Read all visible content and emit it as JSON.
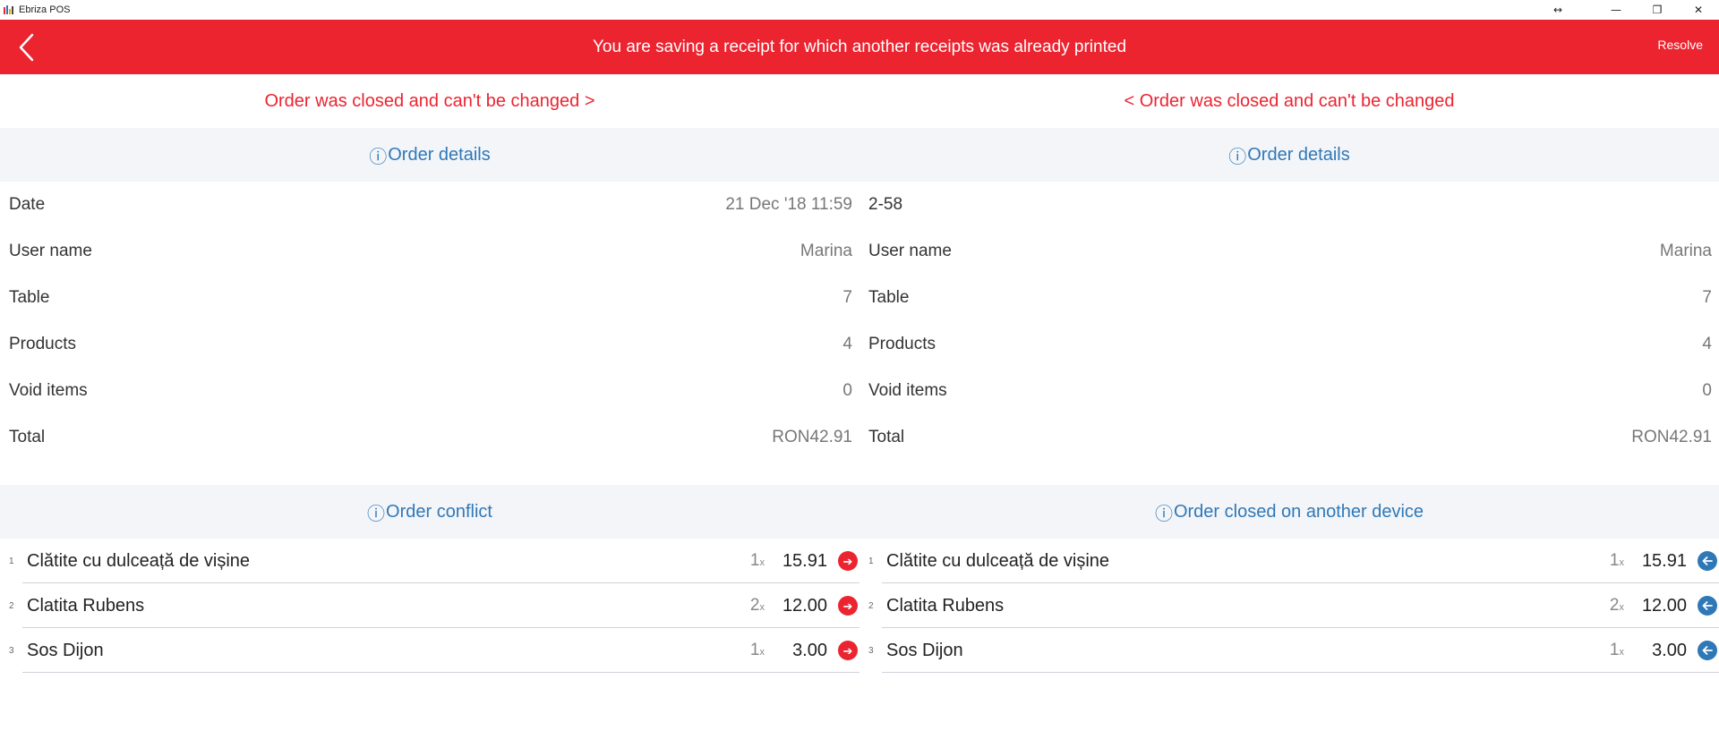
{
  "window": {
    "title": "Ebriza POS",
    "controls": {
      "resize": "↔",
      "minimize": "—",
      "restore": "❐",
      "close": "✕"
    },
    "logo_colors": [
      "#eb2430",
      "#2f78b8",
      "#f2a900",
      "#444444"
    ]
  },
  "banner": {
    "message": "You are saving a receipt for which another receipts was already printed",
    "resolve_label": "Resolve",
    "back_icon": "chevron-left-icon",
    "color": "#eb2430"
  },
  "left": {
    "status_link": "Order was closed and can't be changed >",
    "details_header": "Order details",
    "details": [
      {
        "label": "Date",
        "value": "21 Dec '18 11:59"
      },
      {
        "label": "User name",
        "value": "Marina"
      },
      {
        "label": "Table",
        "value": "7"
      },
      {
        "label": "Products",
        "value": "4"
      },
      {
        "label": "Void items",
        "value": "0"
      },
      {
        "label": "Total",
        "value": "RON42.91"
      }
    ],
    "items_header": "Order conflict",
    "items": [
      {
        "index": "1",
        "name": "Clătite cu dulceață de vișine",
        "qty": "1",
        "qty_suffix": "x",
        "price": "15.91",
        "action_icon": "arrow-right-circle-icon"
      },
      {
        "index": "2",
        "name": "Clatita Rubens",
        "qty": "2",
        "qty_suffix": "x",
        "price": "12.00",
        "action_icon": "arrow-right-circle-icon"
      },
      {
        "index": "3",
        "name": "Sos Dijon",
        "qty": "1",
        "qty_suffix": "x",
        "price": "3.00",
        "action_icon": "arrow-right-circle-icon"
      }
    ]
  },
  "right": {
    "status_link": "< Order was closed and can't be changed",
    "details_header": "Order details",
    "details": [
      {
        "label": "2-58",
        "value": ""
      },
      {
        "label": "User name",
        "value": "Marina"
      },
      {
        "label": "Table",
        "value": "7"
      },
      {
        "label": "Products",
        "value": "4"
      },
      {
        "label": "Void items",
        "value": "0"
      },
      {
        "label": "Total",
        "value": "RON42.91"
      }
    ],
    "items_header": "Order closed on another device",
    "items": [
      {
        "index": "1",
        "name": "Clătite cu dulceață de vișine",
        "qty": "1",
        "qty_suffix": "x",
        "price": "15.91",
        "action_icon": "arrow-left-circle-icon"
      },
      {
        "index": "2",
        "name": "Clatita Rubens",
        "qty": "2",
        "qty_suffix": "x",
        "price": "12.00",
        "action_icon": "arrow-left-circle-icon"
      },
      {
        "index": "3",
        "name": "Sos Dijon",
        "qty": "1",
        "qty_suffix": "x",
        "price": "3.00",
        "action_icon": "arrow-left-circle-icon"
      }
    ]
  },
  "icons": {
    "info": "ⓘ",
    "arrow_right": "➔",
    "arrow_left": "🡐"
  },
  "colors": {
    "accent_red": "#eb2430",
    "accent_blue": "#2f78b8",
    "section_bg": "#f3f5f9"
  }
}
